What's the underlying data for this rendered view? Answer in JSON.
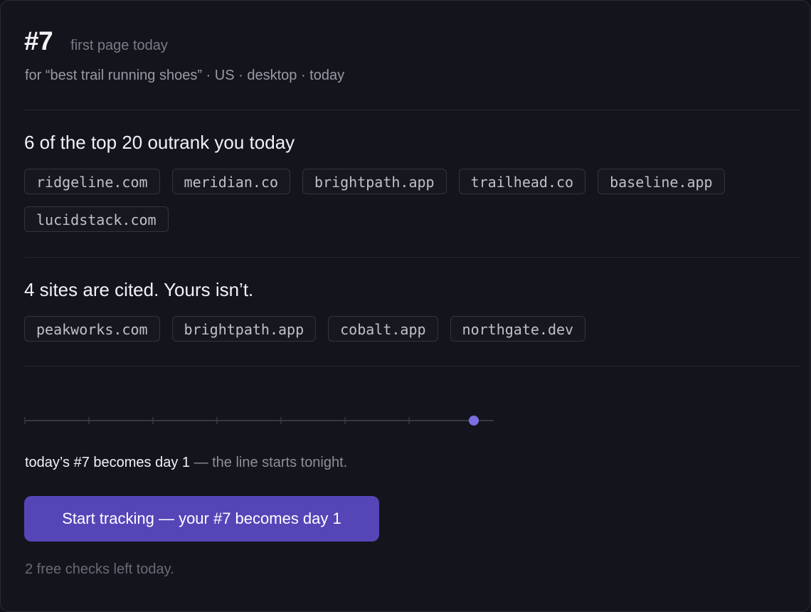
{
  "header": {
    "rank": "#7",
    "rank_caption": "first page today",
    "meta": "for “best trail running shoes” · US · desktop · today"
  },
  "outrank": {
    "title": "6 of the top 20 outrank you today",
    "domains": [
      "ridgeline.com",
      "meridian.co",
      "brightpath.app",
      "trailhead.co",
      "baseline.app",
      "lucidstack.com"
    ]
  },
  "cited": {
    "title": "4 sites are cited. Yours isn’t.",
    "domains": [
      "peakworks.com",
      "brightpath.app",
      "cobalt.app",
      "northgate.dev"
    ]
  },
  "timeline": {
    "segments": 8,
    "current_index": 7,
    "locked_after": true,
    "accent": "#7b6ee0",
    "note_strong": "today’s #7 becomes day 1",
    "note_muted": " — the line starts tonight."
  },
  "cta": {
    "label": "Start tracking — your #7 becomes day 1",
    "color": "#5546b8"
  },
  "footer": {
    "checks_left": "2 free checks left today."
  }
}
